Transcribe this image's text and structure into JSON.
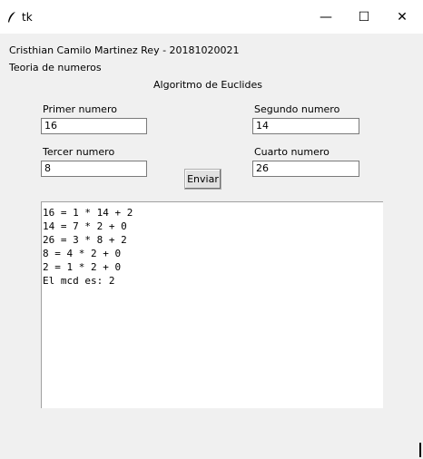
{
  "window": {
    "title": "tk",
    "minimize_glyph": "—",
    "maximize_glyph": "☐",
    "close_glyph": "✕"
  },
  "header": {
    "author": "Cristhian Camilo Martinez Rey - 20181020021",
    "course": "Teoria de numeros",
    "heading": "Algoritmo de Euclides"
  },
  "form": {
    "primer_label": "Primer numero",
    "primer_value": "16",
    "segundo_label": "Segundo numero",
    "segundo_value": "14",
    "tercer_label": "Tercer numero",
    "tercer_value": "8",
    "cuarto_label": "Cuarto numero",
    "cuarto_value": "26",
    "submit_label": "Enviar"
  },
  "output": {
    "lines": [
      "16 = 1 * 14 + 2",
      "14 = 7 * 2 + 0",
      "26 = 3 * 8 + 2",
      "8 = 4 * 2 + 0",
      "2 = 1 * 2 + 0",
      "El mcd es: 2"
    ]
  }
}
